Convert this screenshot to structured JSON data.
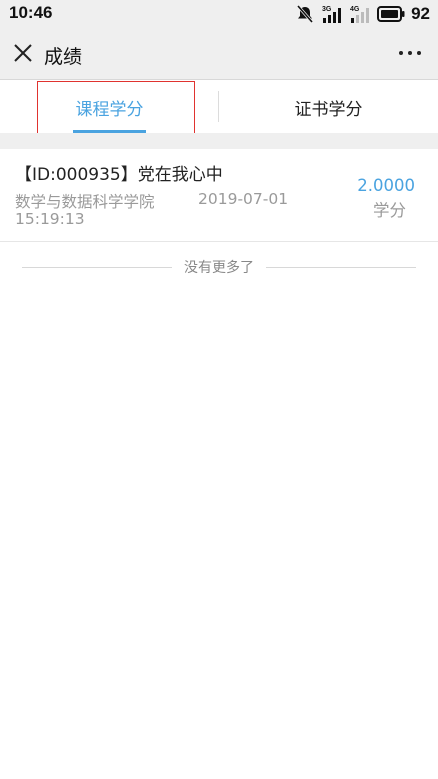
{
  "status_bar": {
    "time": "10:46",
    "battery_level": "92",
    "icons": [
      "mute-icon",
      "signal-3g-icon",
      "signal-4g-icon",
      "battery-icon"
    ],
    "signal_labels": [
      "3G",
      "4G"
    ]
  },
  "title_bar": {
    "title": "成绩",
    "close_icon": "close-icon",
    "more_icon": "more-icon"
  },
  "tabs": [
    {
      "label": "课程学分",
      "active": true
    },
    {
      "label": "证书学分",
      "active": false
    }
  ],
  "list": {
    "items": [
      {
        "title": "【ID:000935】党在我心中",
        "department": "数学与数据科学学院",
        "date": "2019-07-01",
        "time": "15:19:13",
        "score": "2.0000",
        "unit": "学分"
      }
    ],
    "end_text": "没有更多了"
  },
  "colors": {
    "accent": "#4aa3e0",
    "highlight_box": "#e0332f",
    "bar_background": "#efefef"
  }
}
